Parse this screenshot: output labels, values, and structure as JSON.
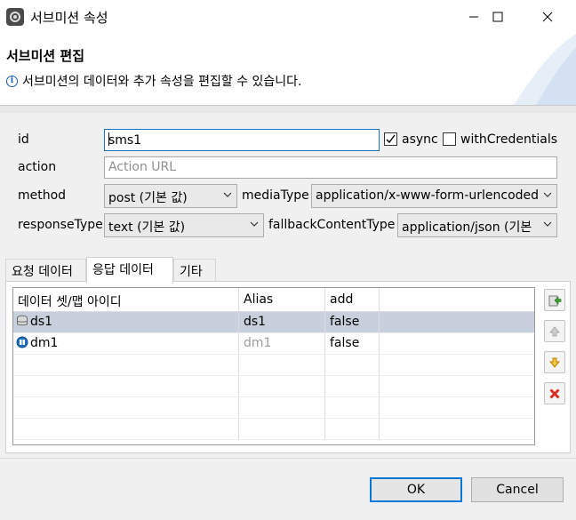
{
  "window": {
    "title": "서브미션 속성"
  },
  "header": {
    "title": "서브미션 편집",
    "description": "서브미션의 데이터와 추가 속성을 편집할 수 있습니다."
  },
  "form": {
    "id_label": "id",
    "id_value": "sms1",
    "async_label": "async",
    "async_checked": true,
    "withCredentials_label": "withCredentials",
    "withCredentials_checked": false,
    "action_label": "action",
    "action_placeholder": "Action URL",
    "method_label": "method",
    "method_value": "post (기본 값)",
    "mediaType_label": "mediaType",
    "mediaType_value": "application/x-www-form-urlencoded",
    "responseType_label": "responseType",
    "responseType_value": "text (기본 값)",
    "fallbackContentType_label": "fallbackContentType",
    "fallbackContentType_value": "application/json (기본"
  },
  "tabs": [
    {
      "label": "요청 데이터",
      "active": false
    },
    {
      "label": "응답 데이터",
      "active": true
    },
    {
      "label": "기타",
      "active": false
    }
  ],
  "table": {
    "columns": [
      "데이터 셋/맵 아이디",
      "Alias",
      "add"
    ],
    "rows": [
      {
        "icon": "dataset-icon",
        "id": "ds1",
        "alias": "ds1",
        "alias_muted": false,
        "add": "false",
        "selected": true
      },
      {
        "icon": "datamap-icon",
        "id": "dm1",
        "alias": "dm1",
        "alias_muted": true,
        "add": "false",
        "selected": false
      }
    ]
  },
  "side_buttons": [
    "add-icon",
    "move-up-icon",
    "move-down-icon",
    "delete-icon"
  ],
  "buttons": {
    "ok": "OK",
    "cancel": "Cancel"
  },
  "colors": {
    "accent": "#0078d7",
    "selection": "#c7d0dc",
    "focus": "#1a73c9"
  }
}
